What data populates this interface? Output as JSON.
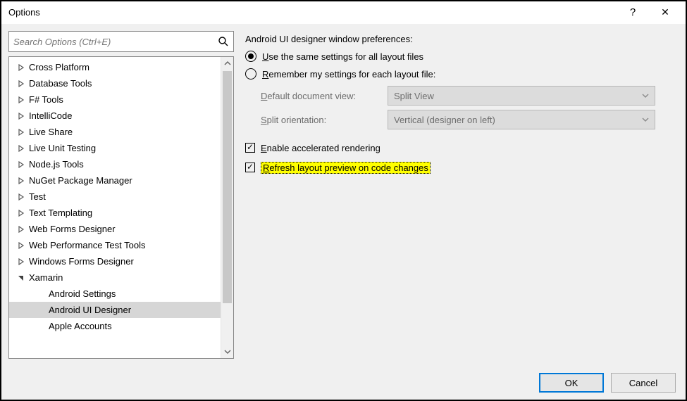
{
  "window": {
    "title": "Options",
    "help_glyph": "?",
    "close_glyph": "✕"
  },
  "search": {
    "placeholder": "Search Options (Ctrl+E)"
  },
  "tree": {
    "items": [
      {
        "label": "Cross Platform",
        "expanded": false,
        "depth": 0
      },
      {
        "label": "Database Tools",
        "expanded": false,
        "depth": 0
      },
      {
        "label": "F# Tools",
        "expanded": false,
        "depth": 0
      },
      {
        "label": "IntelliCode",
        "expanded": false,
        "depth": 0
      },
      {
        "label": "Live Share",
        "expanded": false,
        "depth": 0
      },
      {
        "label": "Live Unit Testing",
        "expanded": false,
        "depth": 0
      },
      {
        "label": "Node.js Tools",
        "expanded": false,
        "depth": 0
      },
      {
        "label": "NuGet Package Manager",
        "expanded": false,
        "depth": 0
      },
      {
        "label": "Test",
        "expanded": false,
        "depth": 0
      },
      {
        "label": "Text Templating",
        "expanded": false,
        "depth": 0
      },
      {
        "label": "Web Forms Designer",
        "expanded": false,
        "depth": 0
      },
      {
        "label": "Web Performance Test Tools",
        "expanded": false,
        "depth": 0
      },
      {
        "label": "Windows Forms Designer",
        "expanded": false,
        "depth": 0
      },
      {
        "label": "Xamarin",
        "expanded": true,
        "depth": 0
      },
      {
        "label": "Android Settings",
        "expanded": null,
        "depth": 1
      },
      {
        "label": "Android UI Designer",
        "expanded": null,
        "depth": 1,
        "selected": true
      },
      {
        "label": "Apple Accounts",
        "expanded": null,
        "depth": 1
      }
    ]
  },
  "prefs": {
    "heading": "Android UI designer window preferences:",
    "radio_same": {
      "prefix": "U",
      "rest": "se the same settings for all layout files",
      "checked": true
    },
    "radio_remember": {
      "prefix": "R",
      "rest": "emember my settings for each layout file:",
      "checked": false
    },
    "default_view_label_prefix": "D",
    "default_view_label_rest": "efault document view:",
    "default_view_value": "Split View",
    "split_orient_label_prefix": "S",
    "split_orient_label_rest": "plit orientation:",
    "split_orient_value": "Vertical (designer on left)",
    "checkbox_accel": {
      "prefix": "E",
      "rest": "nable accelerated rendering",
      "checked": true
    },
    "checkbox_refresh": {
      "prefix": "R",
      "rest": "efresh layout preview on code changes",
      "checked": true
    }
  },
  "buttons": {
    "ok": "OK",
    "cancel": "Cancel"
  }
}
